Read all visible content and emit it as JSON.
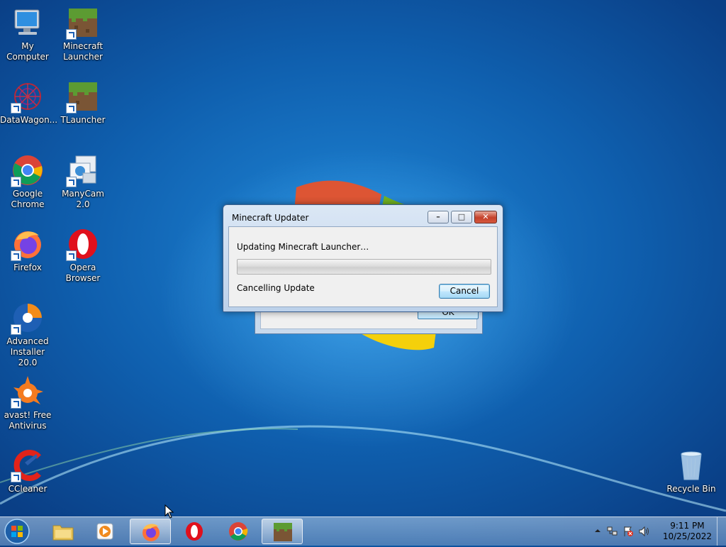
{
  "desktop": {
    "icons": [
      {
        "label": "My Computer",
        "icon": "my-computer-icon"
      },
      {
        "label": "Minecraft Launcher",
        "icon": "minecraft-icon"
      },
      {
        "label": "DataWagon...",
        "icon": "datawagon-icon"
      },
      {
        "label": "TLauncher",
        "icon": "minecraft-icon"
      },
      {
        "label": "Google Chrome",
        "icon": "chrome-icon"
      },
      {
        "label": "ManyCam 2.0",
        "icon": "manycam-icon"
      },
      {
        "label": "Firefox",
        "icon": "firefox-icon"
      },
      {
        "label": "Opera Browser",
        "icon": "opera-icon"
      },
      {
        "label": "Advanced Installer 20.0",
        "icon": "advanced-installer-icon"
      },
      {
        "label": "avast! Free Antivirus",
        "icon": "avast-icon"
      },
      {
        "label": "CCleaner",
        "icon": "ccleaner-icon"
      },
      {
        "label": "Recycle Bin",
        "icon": "recycle-bin-icon"
      }
    ]
  },
  "background_dialog": {
    "ok_label": "OK"
  },
  "dialog": {
    "title": "Minecraft Updater",
    "message": "Updating Minecraft Launcher…",
    "progress": 0,
    "status": "Cancelling Update",
    "cancel_label": "Cancel",
    "minimize_glyph": "–",
    "maximize_glyph": "□",
    "close_glyph": "✕"
  },
  "taskbar": {
    "pinned": [
      {
        "name": "explorer",
        "icon": "folder-icon",
        "active": false
      },
      {
        "name": "media-player",
        "icon": "media-player-icon",
        "active": false
      },
      {
        "name": "firefox",
        "icon": "firefox-icon",
        "active": true
      },
      {
        "name": "opera",
        "icon": "opera-icon",
        "active": false
      },
      {
        "name": "chrome",
        "icon": "chrome-icon",
        "active": false
      },
      {
        "name": "minecraft",
        "icon": "minecraft-icon",
        "active": true
      }
    ],
    "clock": {
      "time": "9:11 PM",
      "date": "10/25/2022"
    }
  },
  "colors": {
    "accent": "#1f86d6",
    "progress_fill": "#06b025"
  }
}
